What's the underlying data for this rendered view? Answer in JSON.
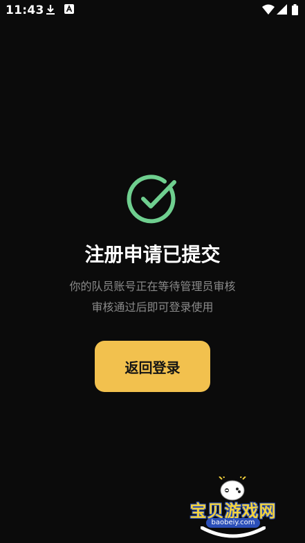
{
  "status_bar": {
    "time": "11:43",
    "icons": [
      "download-icon",
      "a-notification-icon",
      "wifi-icon",
      "signal-icon",
      "battery-icon"
    ]
  },
  "main": {
    "icon": "check-circle-icon",
    "title": "注册申请已提交",
    "message_line1": "你的队员账号正在等待管理员审核",
    "message_line2": "审核通过后即可登录使用",
    "back_button_label": "返回登录"
  },
  "watermark": {
    "text": "宝贝游戏网",
    "url": "baobeiy.com"
  },
  "colors": {
    "background": "#0b0b0b",
    "accent": "#f2c14e",
    "success": "#6fcf8f",
    "message": "#8a8a8a"
  }
}
